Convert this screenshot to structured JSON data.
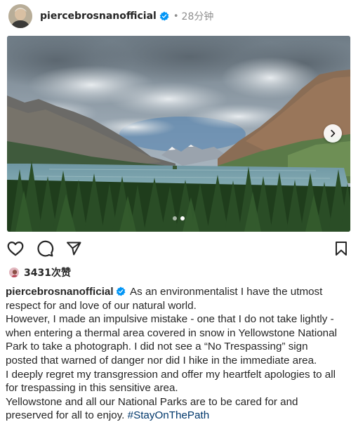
{
  "post": {
    "username": "piercebrosnanofficial",
    "separator": "•",
    "time": "28分钟"
  },
  "carousel": {
    "page_count": 2,
    "active_index": 1
  },
  "likes": {
    "text": "3431次赞"
  },
  "caption": {
    "username": "piercebrosnanofficial",
    "lines": [
      "As an environmentalist I have the utmost",
      "respect for and love of our natural world.",
      "However, I made an impulsive mistake - one that I do not take lightly -",
      "when entering a thermal area covered in snow in Yellowstone National",
      "Park to take a photograph. I did not see a “No Trespassing” sign",
      "posted that warned of danger nor did I hike in the immediate area.",
      "I deeply regret my transgression and offer my heartfelt apologies to all",
      "for trespassing in this sensitive area.",
      "Yellowstone and all our National Parks are to be cared for and",
      "preserved for all to enjoy. "
    ],
    "hashtag": "#StayOnThePath"
  },
  "icons": {
    "verified": "verified-badge-icon",
    "like": "heart-icon",
    "comment": "comment-bubble-icon",
    "share": "paper-plane-icon",
    "save": "bookmark-icon",
    "next": "chevron-right-icon"
  },
  "colors": {
    "verified_blue": "#0095f6",
    "text": "#262626",
    "muted": "#8e8e8e",
    "hashtag": "#00376b"
  }
}
